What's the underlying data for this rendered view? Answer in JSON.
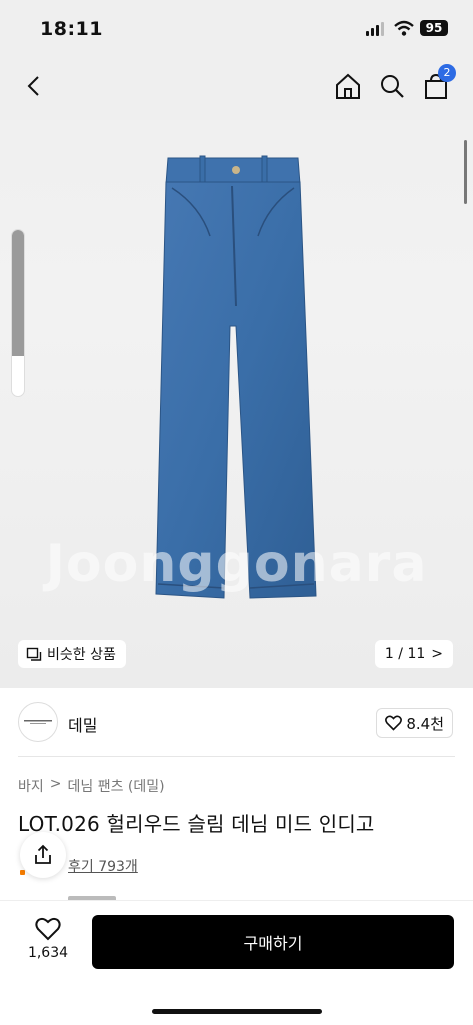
{
  "status_bar": {
    "time": "18:11",
    "battery": "95"
  },
  "nav": {
    "cart_count": "2"
  },
  "gallery": {
    "watermark": "Joonggonara",
    "similar_label": "비슷한 상품",
    "page_counter": "1 / 11",
    "page_chevron": ">",
    "image_slider_level": 0.76
  },
  "seller": {
    "name": "데밀",
    "likes": "8.4천"
  },
  "breadcrumb": {
    "level1": "바지",
    "sep": ">",
    "level2": "데님 팬츠 (데밀)"
  },
  "product": {
    "title": "LOT.026 헐리우드 슬림 데님 미드 인디고"
  },
  "reviews": {
    "label": "후기 793개"
  },
  "bottom": {
    "wish_count": "1,634",
    "buy_label": "구매하기"
  },
  "icons": [
    "back-icon",
    "home-icon",
    "search-icon",
    "cart-icon",
    "similar-icon",
    "heart-icon",
    "share-icon"
  ],
  "colors": {
    "accent": "#2d6be4",
    "buy": "#000000",
    "denim": "#3a6ea8"
  }
}
